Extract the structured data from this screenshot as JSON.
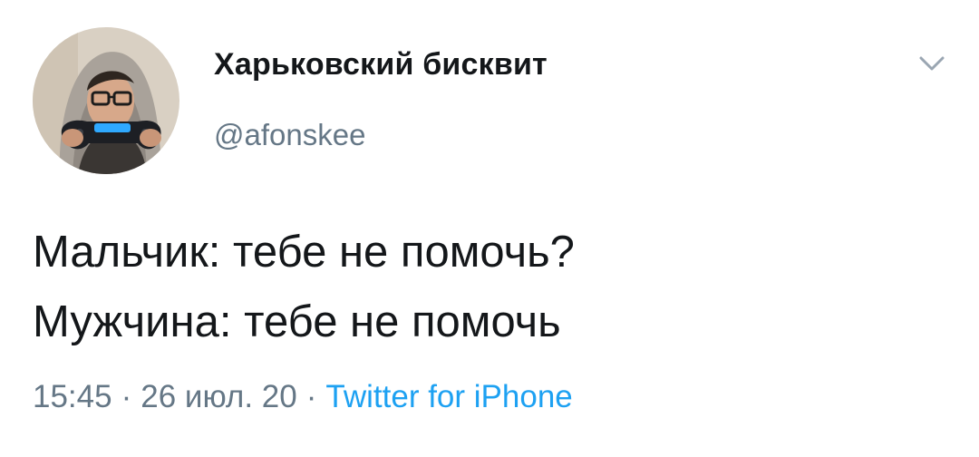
{
  "author": {
    "display_name": "Харьковский бисквит",
    "handle": "@afonskee",
    "avatar_icon": "profile-photo"
  },
  "menu": {
    "icon": "chevron-down-icon"
  },
  "tweet": {
    "lines": [
      "Мальчик: тебе не помочь?",
      "Мужчина: тебе не помочь"
    ]
  },
  "meta": {
    "time": "15:45",
    "separator": "·",
    "date": "26 июл. 20",
    "source": "Twitter for iPhone"
  },
  "colors": {
    "text_primary": "#14171a",
    "text_secondary": "#657786",
    "link": "#1da1f2",
    "background": "#ffffff"
  }
}
